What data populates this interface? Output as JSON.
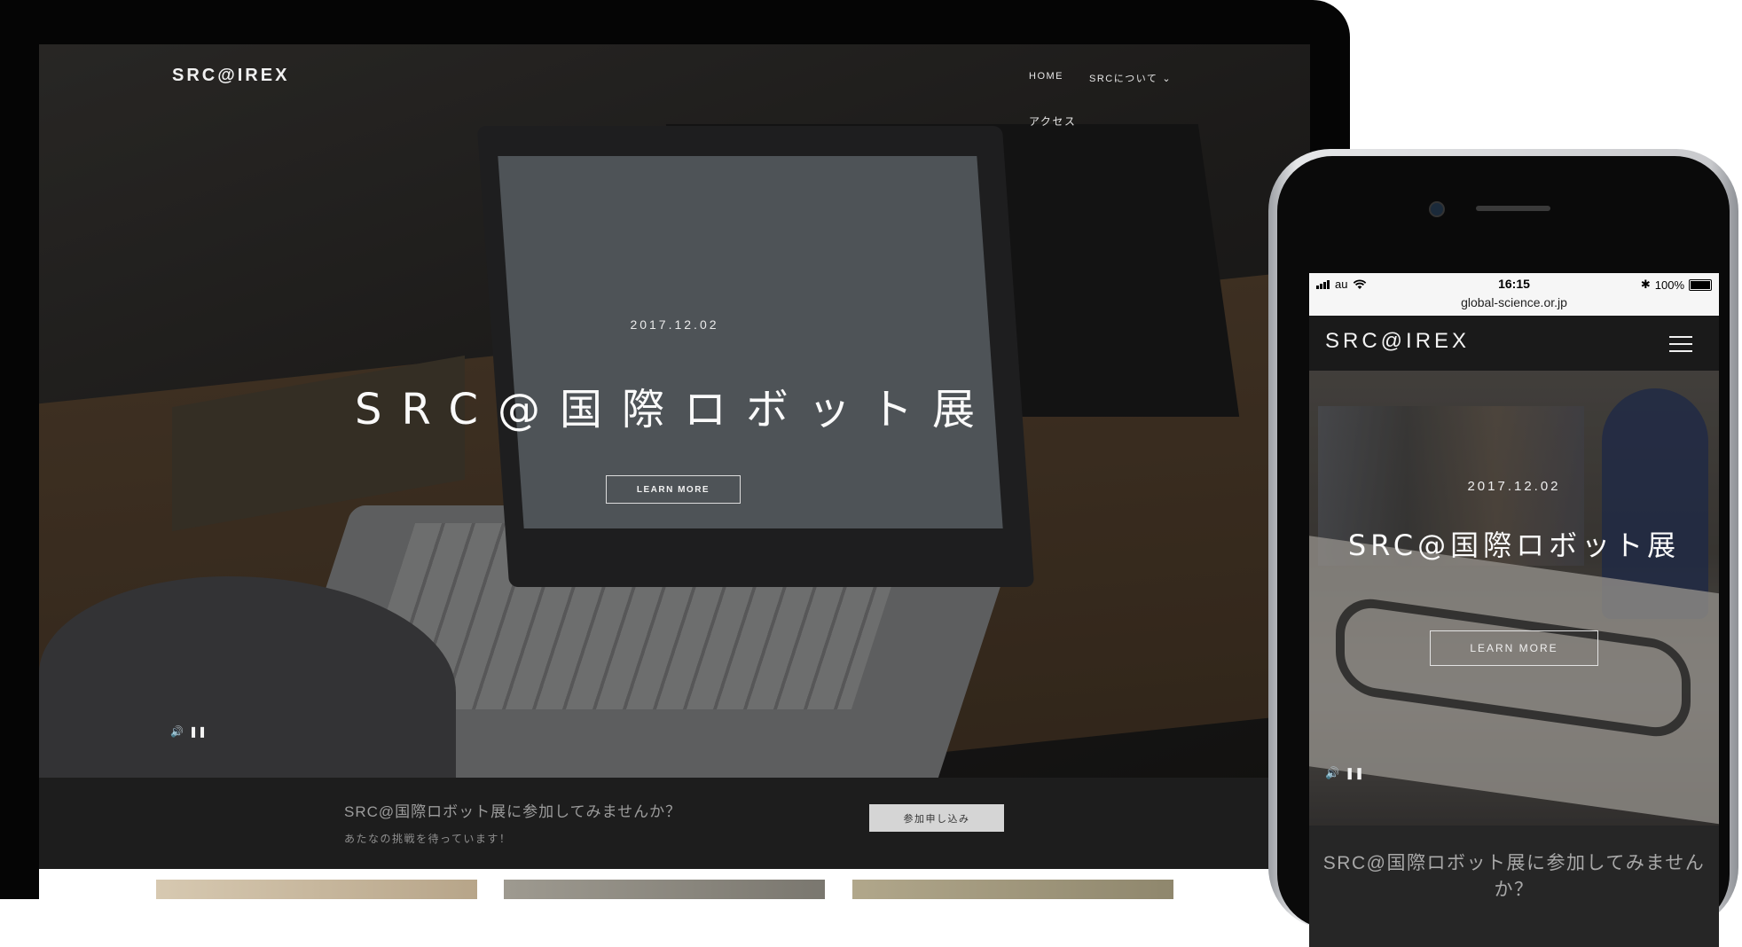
{
  "desktop": {
    "logo": "SRC@IREX",
    "nav": {
      "home": "HOME",
      "about": "SRCについて",
      "access": "アクセス"
    },
    "hero": {
      "date": "2017.12.02",
      "title": "SRC@国際ロボット展",
      "button": "LEARN MORE"
    },
    "controls": {
      "volume": "🔊",
      "pause": "❚❚"
    },
    "cta": {
      "title": "SRC@国際ロボット展に参加してみませんか？",
      "subtitle": "あたなの挑戦を待っています！",
      "button": "参加申し込み"
    }
  },
  "phone": {
    "status": {
      "carrier": "au",
      "time": "16:15",
      "battery": "100%",
      "url": "global-science.or.jp"
    },
    "logo": "SRC@IREX",
    "hero": {
      "date": "2017.12.02",
      "title": "SRC@国際ロボット展",
      "button": "LEARN MORE"
    },
    "controls": {
      "volume": "🔊",
      "pause": "❚❚"
    },
    "cta": {
      "title": "SRC@国際ロボット展に参加してみませんか？"
    }
  },
  "icons": {
    "chevron": "chevron-down-icon",
    "wifi": "wifi-icon",
    "bluetooth": "bluetooth-icon",
    "menu": "hamburger-menu-icon"
  }
}
